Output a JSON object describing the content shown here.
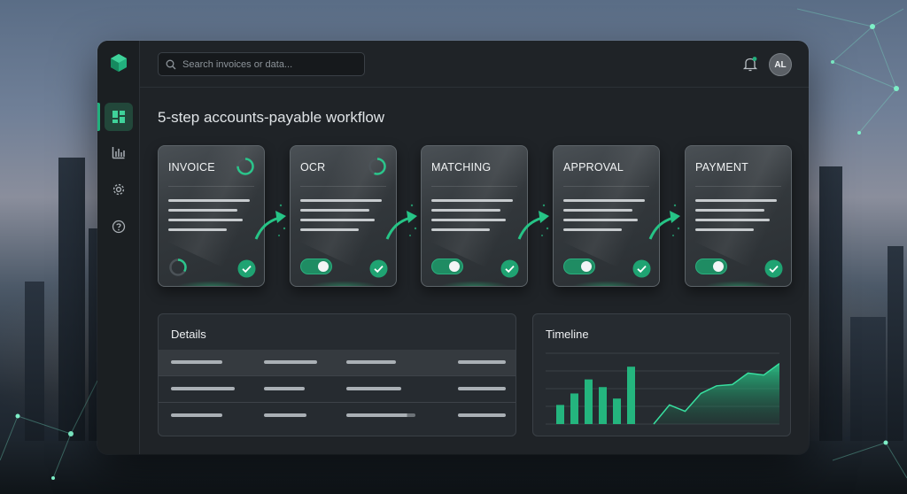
{
  "search": {
    "placeholder": "Search invoices or data..."
  },
  "user": {
    "initials": "AL"
  },
  "page": {
    "title": "5-step accounts-payable workflow"
  },
  "steps": [
    {
      "label": "INVOICE",
      "status": "complete"
    },
    {
      "label": "OCR",
      "status": "complete",
      "toggle": "on"
    },
    {
      "label": "MATCHING",
      "status": "complete",
      "toggle": "on"
    },
    {
      "label": "APPROVAL",
      "status": "complete",
      "toggle": "on"
    },
    {
      "label": "PAYMENT",
      "status": "complete",
      "toggle": "on"
    }
  ],
  "details": {
    "title": "Details"
  },
  "timeline": {
    "title": "Timeline"
  },
  "chart_data": {
    "type": "bar",
    "bars": [
      0.3,
      0.48,
      0.7,
      0.58,
      0.4,
      0.9
    ],
    "area": [
      0.0,
      0.3,
      0.2,
      0.48,
      0.6,
      0.62,
      0.8,
      0.77,
      0.95
    ]
  },
  "colors": {
    "accent": "#22b07d",
    "accent_dark": "#1f8c63",
    "window_bg": "#1f2327"
  }
}
